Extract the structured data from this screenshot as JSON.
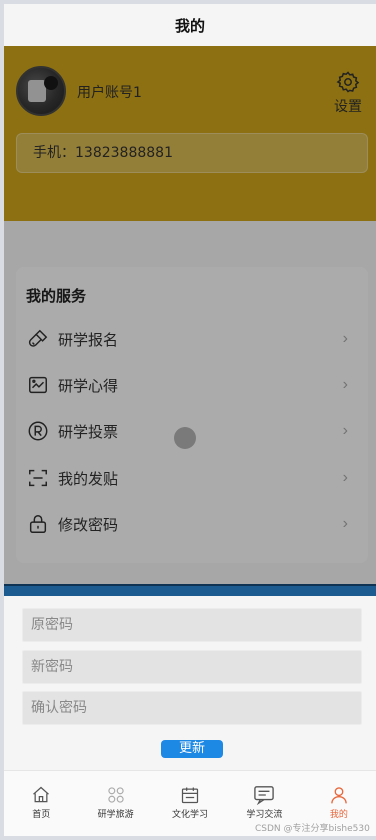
{
  "header": {
    "title": "我的"
  },
  "profile": {
    "username": "用户账号1",
    "settings_label": "设置",
    "phone": "手机：13823888881"
  },
  "services": {
    "title": "我的服务",
    "items": [
      {
        "label": "研学报名",
        "icon": "brush-icon"
      },
      {
        "label": "研学心得",
        "icon": "chart-icon"
      },
      {
        "label": "研学投票",
        "icon": "registered-icon"
      },
      {
        "label": "我的发贴",
        "icon": "scan-icon"
      },
      {
        "label": "修改密码",
        "icon": "lock-icon"
      }
    ],
    "chevron": "›"
  },
  "password_form": {
    "old_placeholder": "原密码",
    "new_placeholder": "新密码",
    "confirm_placeholder": "确认密码",
    "update_label": "更新"
  },
  "tabbar": {
    "items": [
      {
        "label": "首页",
        "icon": "home-icon"
      },
      {
        "label": "研学旅游",
        "icon": "grid-icon"
      },
      {
        "label": "文化学习",
        "icon": "calendar-icon"
      },
      {
        "label": "学习交流",
        "icon": "chat-icon"
      },
      {
        "label": "我的",
        "icon": "user-icon",
        "active": true
      }
    ]
  },
  "watermark": "CSDN @专注分享bishe530",
  "colors": {
    "profile_bg": "#cfa51a",
    "accent_blue": "#1e88e5",
    "active_tab": "#e8663b",
    "strip": "#1b5b8f"
  }
}
